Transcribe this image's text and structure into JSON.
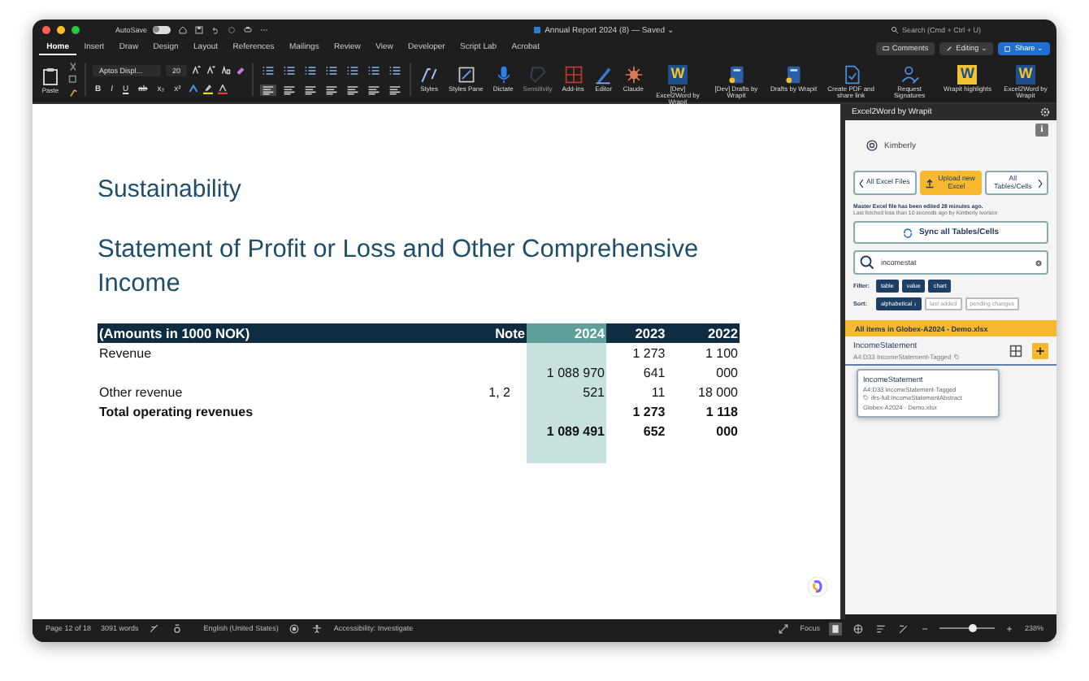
{
  "title_bar": {
    "autosave_label": "AutoSave",
    "autosave_on": false,
    "document_title": "Annual Report 2024 (8) — Saved ⌄",
    "search_placeholder": "Search (Cmd + Ctrl + U)"
  },
  "tabs": [
    {
      "label": "Home",
      "selected": true
    },
    {
      "label": "Insert",
      "selected": false
    },
    {
      "label": "Draw",
      "selected": false
    },
    {
      "label": "Design",
      "selected": false
    },
    {
      "label": "Layout",
      "selected": false
    },
    {
      "label": "References",
      "selected": false
    },
    {
      "label": "Mailings",
      "selected": false
    },
    {
      "label": "Review",
      "selected": false
    },
    {
      "label": "View",
      "selected": false
    },
    {
      "label": "Developer",
      "selected": false
    },
    {
      "label": "Script Lab",
      "selected": false
    },
    {
      "label": "Acrobat",
      "selected": false
    }
  ],
  "header_buttons": [
    {
      "label": "Comments",
      "kind": "comments"
    },
    {
      "label": "Editing ⌄",
      "kind": "editing"
    },
    {
      "label": "Share ⌄",
      "kind": "share"
    }
  ],
  "ribbon": {
    "paste_label": "Paste",
    "font_name": "Aptos Displ...",
    "font_size": "20",
    "font_buttons": [
      "B",
      "I",
      "U",
      "ab",
      "x₂",
      "x²"
    ],
    "big_buttons": [
      {
        "label": "Styles",
        "kind": "styles",
        "disabled": false
      },
      {
        "label": "Styles Pane",
        "kind": "pane",
        "disabled": false
      },
      {
        "label": "Dictate",
        "kind": "mic",
        "disabled": false
      },
      {
        "label": "Sensitivity",
        "kind": "sensitivity",
        "disabled": true
      },
      {
        "label": "Add-ins",
        "kind": "grid",
        "disabled": false
      },
      {
        "label": "Editor",
        "kind": "pen",
        "disabled": false
      },
      {
        "label": "Claude",
        "kind": "burst",
        "disabled": false
      },
      {
        "label": "[Dev] Excel2Word by Wrapit",
        "kind": "logo",
        "logo_text": "W",
        "color": "#1f4e8c",
        "disabled": false
      },
      {
        "label": "[Dev] Drafts by Wrapit",
        "kind": "drafts",
        "disabled": false
      },
      {
        "label": "Drafts by Wrapit",
        "kind": "drafts",
        "disabled": false
      },
      {
        "label": "Create PDF and share link",
        "kind": "pdf",
        "disabled": false
      },
      {
        "label": "Request Signatures",
        "kind": "sign",
        "disabled": false
      },
      {
        "label": "Wrapit highlights",
        "kind": "logo",
        "logo_text": "W",
        "color": "#f2c230",
        "disabled": false
      },
      {
        "label": "Excel2Word by Wrapit",
        "kind": "logo",
        "logo_text": "W",
        "color": "#1f4e8c",
        "disabled": false
      }
    ]
  },
  "document": {
    "heading": "Sustainability",
    "title": "Statement of Profit or Loss and Other Comprehensive Income",
    "table": {
      "columns": [
        {
          "label": "(Amounts in 1000 NOK)",
          "highlighted": false
        },
        {
          "label": "Note",
          "highlighted": false
        },
        {
          "label": "2024",
          "highlighted": true
        },
        {
          "label": "2023",
          "highlighted": false
        },
        {
          "label": "2022",
          "highlighted": false
        }
      ],
      "rows": [
        {
          "cells": [
            "Revenue",
            null,
            null,
            "1 273",
            "1 100"
          ],
          "bold": false
        },
        {
          "cells": [
            null,
            null,
            "1 088 970",
            "641",
            "000"
          ],
          "bold": false
        },
        {
          "cells": [
            "Other revenue",
            "1, 2",
            "521",
            "11",
            "18 000"
          ],
          "bold": false
        },
        {
          "cells": [
            "Total operating revenues",
            null,
            null,
            "1 273",
            "1 118"
          ],
          "bold": true
        },
        {
          "cells": [
            null,
            null,
            "1 089 491",
            "652",
            "000"
          ],
          "bold": true
        }
      ]
    }
  },
  "pane": {
    "title": "Excel2Word by Wrapit",
    "info_label": "i",
    "user": "Kimberly",
    "nav": [
      {
        "label": "All Excel Files",
        "kind": "back",
        "selected": false
      },
      {
        "label": "Upload new Excel",
        "kind": "upload",
        "selected": true
      },
      {
        "label": "All Tables/Cells",
        "kind": "forward",
        "selected": false
      }
    ],
    "status_lines": [
      "Master Excel file has been edited 28 minutes ago.",
      "Last fetched less than 10 seconds ago by Kimberly Iversen"
    ],
    "sync_label": "Sync all Tables/Cells",
    "search_value": "incomestat",
    "filter_label": "Filter:",
    "filters": [
      {
        "label": "table",
        "selected": true
      },
      {
        "label": "value",
        "selected": true
      },
      {
        "label": "chart",
        "selected": true
      }
    ],
    "sort_label": "Sort:",
    "sorts": [
      {
        "label": "alphabetical ↓",
        "selected": true
      },
      {
        "label": "last added",
        "selected": false
      },
      {
        "label": "pending changes",
        "selected": false
      }
    ],
    "banner": "All items in Globex-A2024 - Demo.xlsx",
    "item": {
      "name": "IncomeStatement",
      "range": "A4:D33 IncomeStatement-Tagged"
    },
    "tooltip": {
      "name": "IncomeStatement",
      "range": "A4:D33 IncomeStatement-Tagged",
      "tag": "ifrs-full:IncomeStatementAbstract",
      "file": "Globex-A2024 - Demo.xlsx"
    }
  },
  "status_bar": {
    "page": "Page 12 of 18",
    "words": "3091 words",
    "language": "English (United States)",
    "accessibility": "Accessibility: Investigate",
    "focus": "Focus",
    "zoom_slider": {
      "level": 0.6
    },
    "zoom": "238%"
  }
}
